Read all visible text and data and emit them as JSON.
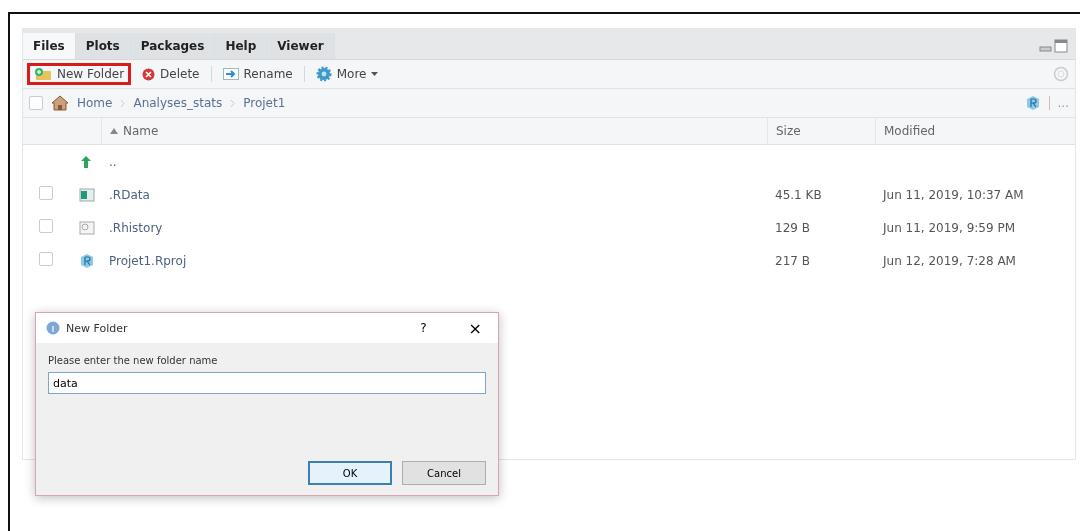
{
  "tabs": [
    {
      "label": "Files",
      "selected": true
    },
    {
      "label": "Plots",
      "selected": false
    },
    {
      "label": "Packages",
      "selected": false
    },
    {
      "label": "Help",
      "selected": false
    },
    {
      "label": "Viewer",
      "selected": false
    }
  ],
  "toolbar": [
    {
      "kind": "new-folder",
      "label": "New Folder",
      "highlighted": true
    },
    {
      "kind": "delete",
      "label": "Delete",
      "highlighted": false
    },
    {
      "kind": "rename",
      "label": "Rename",
      "highlighted": false
    },
    {
      "kind": "more",
      "label": "More",
      "highlighted": false
    }
  ],
  "select_all_checked": false,
  "breadcrumb": [
    "Home",
    "Analyses_stats",
    "Projet1"
  ],
  "breadcrumb_more": "...",
  "table": {
    "columns": [
      "Name",
      "Size",
      "Modified"
    ],
    "parent": "..",
    "rows": [
      {
        "kind": "rdata",
        "name": ".RData",
        "size": "45.1 KB",
        "modified": "Jun 11, 2019, 10:37 AM",
        "checked": false
      },
      {
        "kind": "history",
        "name": ".Rhistory",
        "size": "129 B",
        "modified": "Jun 11, 2019, 9:59 PM",
        "checked": false
      },
      {
        "kind": "rproj",
        "name": "Projet1.Rproj",
        "size": "217 B",
        "modified": "Jun 12, 2019, 7:28 AM",
        "checked": false
      }
    ]
  },
  "dialog": {
    "title": "New Folder",
    "help": "?",
    "close": "×",
    "prompt": "Please enter the new folder name",
    "value": "data",
    "buttons": [
      "OK",
      "Cancel"
    ]
  }
}
